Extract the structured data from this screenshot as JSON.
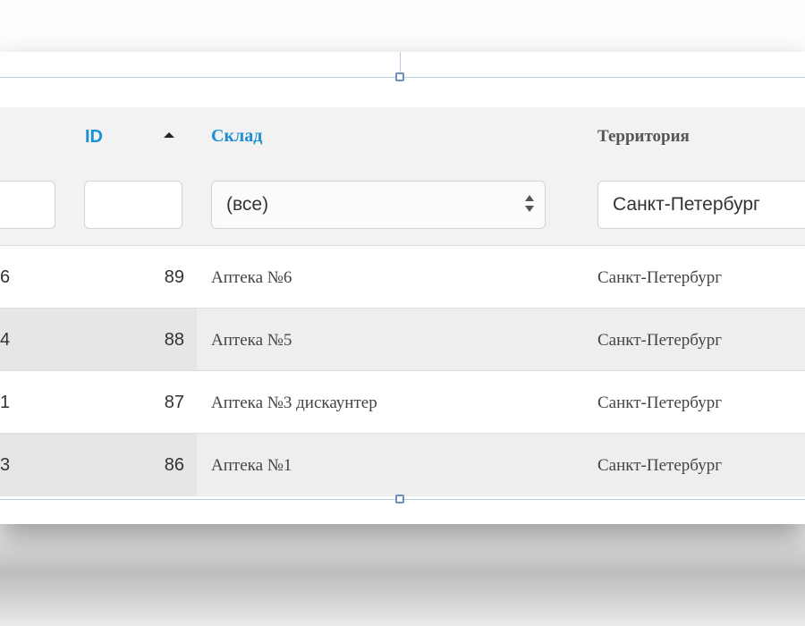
{
  "table": {
    "headers": {
      "id": "ID",
      "warehouse": "Склад",
      "territory": "Территория"
    },
    "filters": {
      "warehouse_selected": "(все)",
      "territory_value": "Санкт-Петербург"
    },
    "rows": [
      {
        "left": "6",
        "id": "89",
        "warehouse": "Аптека №6",
        "territory": "Санкт-Петербург"
      },
      {
        "left": "4",
        "id": "88",
        "warehouse": "Аптека №5",
        "territory": "Санкт-Петербург"
      },
      {
        "left": "1",
        "id": "87",
        "warehouse": "Аптека №3 дискаунтер",
        "territory": "Санкт-Петербург"
      },
      {
        "left": "3",
        "id": "86",
        "warehouse": "Аптека №1",
        "territory": "Санкт-Петербург"
      }
    ]
  },
  "colors": {
    "link_header": "#1a8fd6",
    "header_bg": "#f2f2f2",
    "alt_row_bg": "#eeeeee"
  },
  "icons": {
    "sort": "sort-ascending-icon",
    "select_arrows": "select-arrows-icon"
  }
}
